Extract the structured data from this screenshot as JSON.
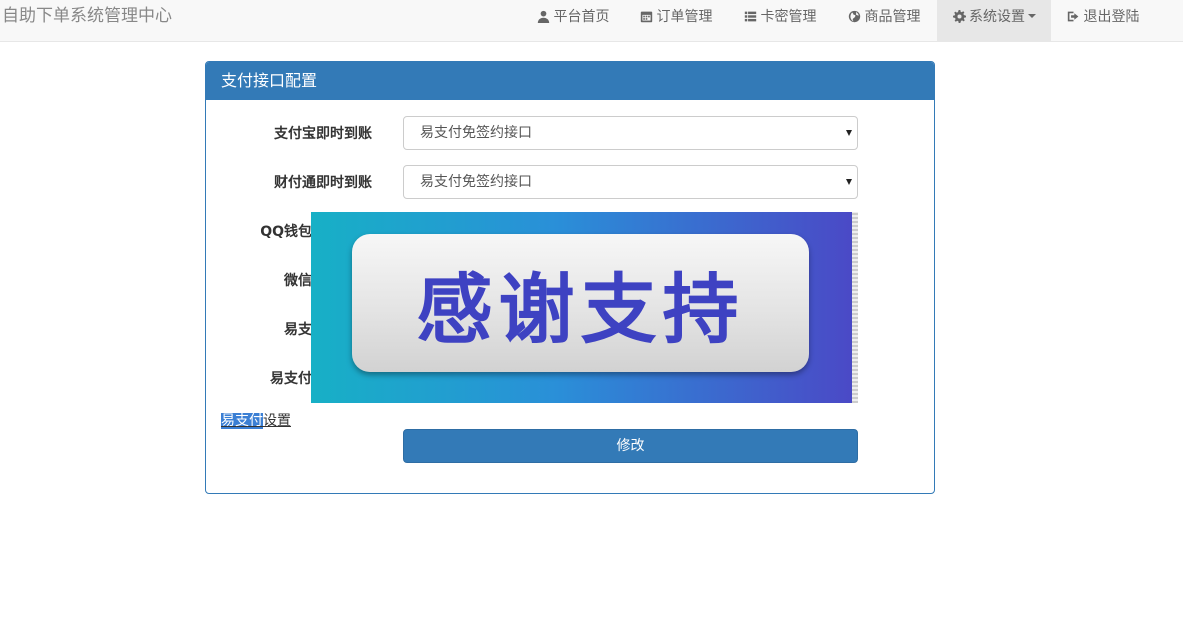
{
  "brand": "自助下单系统管理中心",
  "nav": {
    "items": [
      {
        "label": "平台首页",
        "icon": "user-icon"
      },
      {
        "label": "订单管理",
        "icon": "calendar-icon"
      },
      {
        "label": "卡密管理",
        "icon": "list-icon"
      },
      {
        "label": "商品管理",
        "icon": "globe-icon"
      },
      {
        "label": "系统设置",
        "icon": "gear-icon",
        "active": true,
        "dropdown": true
      },
      {
        "label": "退出登陆",
        "icon": "logout-icon"
      }
    ]
  },
  "panel": {
    "title": "支付接口配置",
    "fields": [
      {
        "label": "支付宝即时到账",
        "value": "易支付免签约接口"
      },
      {
        "label": "财付通即时到账",
        "value": "易支付免签约接口"
      },
      {
        "label": "QQ钱包"
      },
      {
        "label": "微信"
      },
      {
        "label": "易支"
      },
      {
        "label": "易支付"
      }
    ],
    "settings_link": {
      "highlighted": "易支付",
      "rest": "设置"
    },
    "submit_label": "修改"
  },
  "banner": {
    "text": "感谢支持"
  },
  "colors": {
    "primary": "#337ab7",
    "navbar_bg": "#f8f8f8",
    "banner_text": "#3e42c2"
  }
}
